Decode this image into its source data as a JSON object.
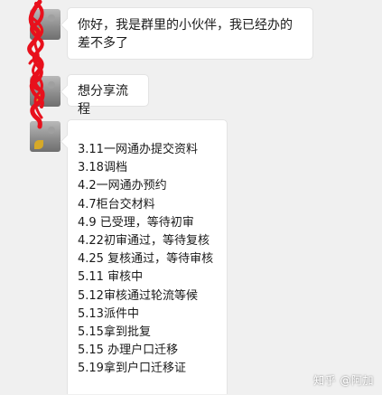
{
  "messages": [
    {
      "text": "你好，我是群里的小伙伴，我已经办的差不多了"
    },
    {
      "text": "想分享流程"
    },
    {
      "steps": [
        "3.11一网通办提交资料",
        "3.18调档",
        "4.2一网通办预约",
        "4.7柜台交材料",
        "4.9 已受理，等待初审",
        "4.22初审通过，等待复核",
        "4.25 复核通过，等待审核",
        "5.11 审核中",
        "5.12审核通过轮流等候",
        "5.13派件中",
        "5.15拿到批复",
        "5.15 办理户口迁移",
        "5.19拿到户口迁移证"
      ]
    }
  ],
  "watermark": "知乎 @阿加",
  "colors": {
    "background": "#f0f0f0",
    "bubble": "#ffffff",
    "scribble": "#e8101c"
  }
}
